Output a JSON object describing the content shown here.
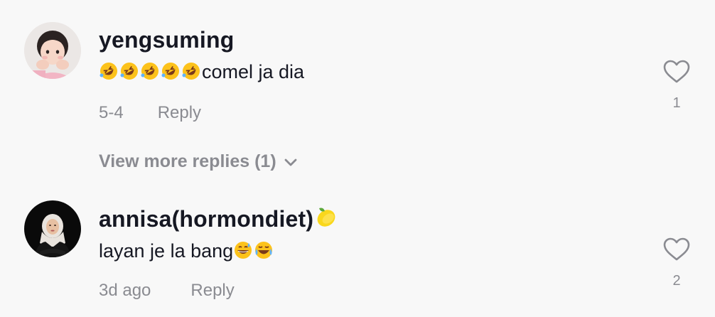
{
  "comments": [
    {
      "username": "yengsuming",
      "text": "comel ja dia",
      "text_emojis": [
        "rolling-on-floor-laughing-emoji",
        "rolling-on-floor-laughing-emoji",
        "rolling-on-floor-laughing-emoji",
        "rolling-on-floor-laughing-emoji",
        "rolling-on-floor-laughing-emoji"
      ],
      "date": "5-4",
      "reply_label": "Reply",
      "like_count": "1"
    },
    {
      "username": "annisa(hormondiet)",
      "username_emoji": "lemon-emoji",
      "text": "layan je la bang",
      "text_emojis": [
        "grinning-sweat-emoji",
        "tears-of-joy-emoji"
      ],
      "date": "3d ago",
      "reply_label": "Reply",
      "like_count": "2"
    }
  ],
  "view_more": {
    "label": "View more replies (1)",
    "icon": "chevron-down-icon"
  },
  "colors": {
    "background": "#f8f8f8",
    "primary_text": "#161823",
    "secondary_text": "#8a8b91"
  }
}
